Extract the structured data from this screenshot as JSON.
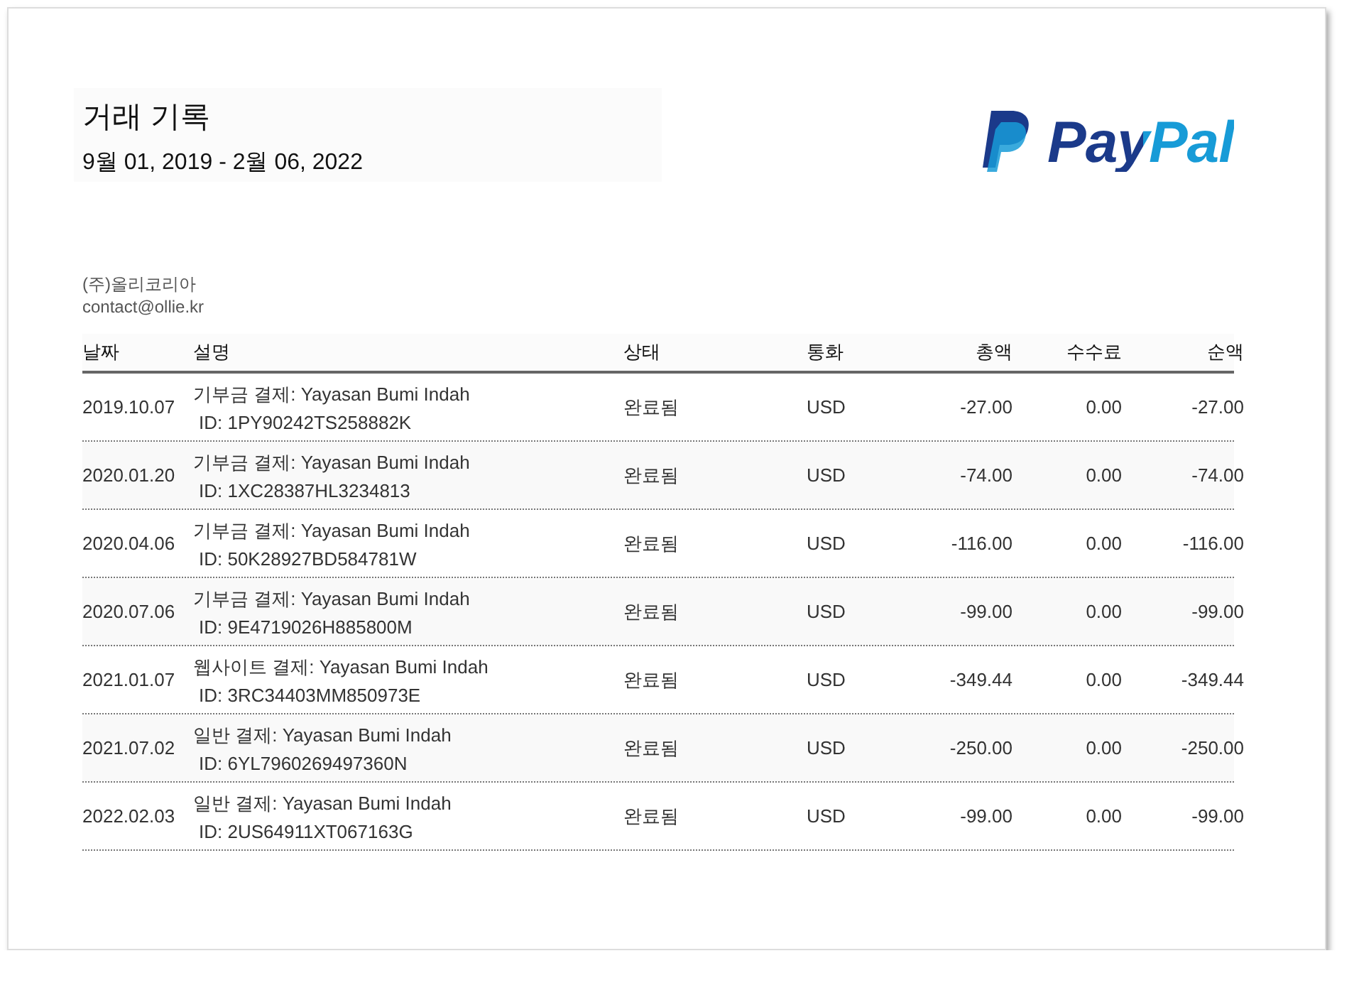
{
  "title": "거래 기록",
  "period": "9월 01, 2019 - 2월 06, 2022",
  "logo": {
    "text": "PayPal"
  },
  "company": {
    "name": "(주)올리코리아",
    "email": "contact@ollie.kr"
  },
  "table": {
    "columns": [
      "날짜",
      "설명",
      "상태",
      "통화",
      "총액",
      "수수료",
      "순액"
    ],
    "rows": [
      {
        "date": "2019.10.07",
        "description": "기부금 결제: Yayasan Bumi Indah",
        "id": "ID: 1PY90242TS258882K",
        "status": "완료됨",
        "currency": "USD",
        "gross": "-27.00",
        "fee": "0.00",
        "net": "-27.00"
      },
      {
        "date": "2020.01.20",
        "description": "기부금 결제: Yayasan Bumi Indah",
        "id": "ID: 1XC28387HL3234813",
        "status": "완료됨",
        "currency": "USD",
        "gross": "-74.00",
        "fee": "0.00",
        "net": "-74.00"
      },
      {
        "date": "2020.04.06",
        "description": "기부금 결제: Yayasan Bumi Indah",
        "id": "ID: 50K28927BD584781W",
        "status": "완료됨",
        "currency": "USD",
        "gross": "-116.00",
        "fee": "0.00",
        "net": "-116.00"
      },
      {
        "date": "2020.07.06",
        "description": "기부금 결제: Yayasan Bumi Indah",
        "id": "ID: 9E4719026H885800M",
        "status": "완료됨",
        "currency": "USD",
        "gross": "-99.00",
        "fee": "0.00",
        "net": "-99.00"
      },
      {
        "date": "2021.01.07",
        "description": "웹사이트 결제: Yayasan Bumi Indah",
        "id": "ID: 3RC34403MM850973E",
        "status": "완료됨",
        "currency": "USD",
        "gross": "-349.44",
        "fee": "0.00",
        "net": "-349.44"
      },
      {
        "date": "2021.07.02",
        "description": "일반 결제: Yayasan Bumi Indah",
        "id": "ID: 6YL7960269497360N",
        "status": "완료됨",
        "currency": "USD",
        "gross": "-250.00",
        "fee": "0.00",
        "net": "-250.00"
      },
      {
        "date": "2022.02.03",
        "description": "일반 결제: Yayasan Bumi Indah",
        "id": "ID: 2US64911XT067163G",
        "status": "완료됨",
        "currency": "USD",
        "gross": "-99.00",
        "fee": "0.00",
        "net": "-99.00"
      }
    ]
  }
}
